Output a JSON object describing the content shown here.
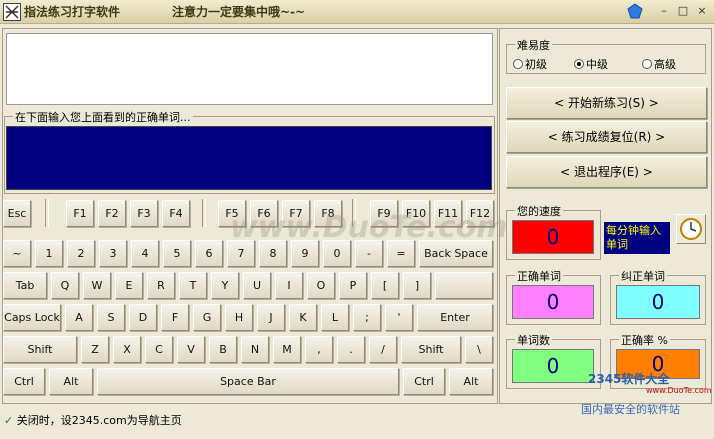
{
  "window": {
    "title": "指法练习打字软件",
    "subtitle": "注意力一定要集中哦~-~",
    "controls": {
      "minimize": "–",
      "maximize": "□",
      "close": "×"
    }
  },
  "input_panel": {
    "label": "在下面输入您上面看到的正确单词..."
  },
  "keyboard": {
    "row0": [
      "Esc",
      "F1",
      "F2",
      "F3",
      "F4",
      "F5",
      "F6",
      "F7",
      "F8",
      "F9",
      "F10",
      "F11",
      "F12"
    ],
    "row1": [
      "~",
      "1",
      "2",
      "3",
      "4",
      "5",
      "6",
      "7",
      "8",
      "9",
      "0",
      "-",
      "=",
      "Back Space"
    ],
    "row2": [
      "Tab",
      "Q",
      "W",
      "E",
      "R",
      "T",
      "Y",
      "U",
      "I",
      "O",
      "P",
      "[",
      "]",
      ""
    ],
    "row3": [
      "Caps Lock",
      "A",
      "S",
      "D",
      "F",
      "G",
      "H",
      "J",
      "K",
      "L",
      ";",
      "'",
      "Enter"
    ],
    "row4": [
      "Shift",
      "Z",
      "X",
      "C",
      "V",
      "B",
      "N",
      "M",
      ",",
      ".",
      "/",
      "Shift",
      "\\"
    ],
    "row5": [
      "Ctrl",
      "Alt",
      "Space Bar",
      "Ctrl",
      "Alt"
    ]
  },
  "difficulty": {
    "label": "难易度",
    "options": [
      "初级",
      "中级",
      "高级"
    ],
    "selected": "中级"
  },
  "buttons": {
    "start": "< 开始新练习(S) >",
    "reset": "< 练习成绩复位(R) >",
    "exit": "< 退出程序(E) >"
  },
  "stats": {
    "speed_label": "您的速度",
    "speed_value": "0",
    "speed_note": "每分钟输入单词",
    "correct_label": "正确单词",
    "correct_value": "0",
    "fixed_label": "纠正单词",
    "fixed_value": "0",
    "count_label": "单词数",
    "count_value": "0",
    "accuracy_label": "正确率 %",
    "accuracy_value": "0"
  },
  "colors": {
    "speed": "#ff0000",
    "correct": "#ff80ff",
    "fixed": "#80ffff",
    "count": "#80ff80",
    "accuracy": "#ff8000"
  },
  "status": {
    "text": "关闭时，设2345.com为导航主页"
  },
  "footer": {
    "logo": "2345软件大全",
    "url": "www.DuoTe.com",
    "tagline": "国内最安全的软件站",
    "watermark": "www.DuoTe.com"
  }
}
